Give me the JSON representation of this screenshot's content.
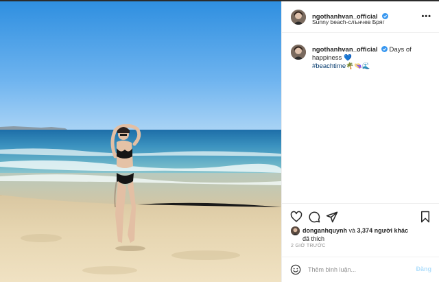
{
  "post": {
    "username": "ngothanhvan_official",
    "location": "Sunny beach-слънчев Бряг",
    "more_icon": "more-horizontal-icon"
  },
  "caption": {
    "username": "ngothanhvan_official",
    "text": "Days of happiness",
    "heart_emoji": "💙",
    "hashtag": "#beachtime",
    "emojis": "🌴👒🌊"
  },
  "actions": {
    "icons": [
      "heart-icon",
      "comment-icon",
      "share-icon",
      "bookmark-icon"
    ]
  },
  "likes": {
    "first_user": "donganhquynh",
    "joiner": "và",
    "count": "3,374",
    "suffix": "người khác",
    "line2": "đã thích"
  },
  "timestamp": "2 GIỜ TRƯỚC",
  "comment": {
    "placeholder": "Thêm bình luận...",
    "post_label": "Đăng"
  },
  "colors": {
    "verified": "#3897f0",
    "hashtag": "#00376b",
    "post_disabled": "#b2dffc",
    "muted": "#8e8e8e"
  }
}
